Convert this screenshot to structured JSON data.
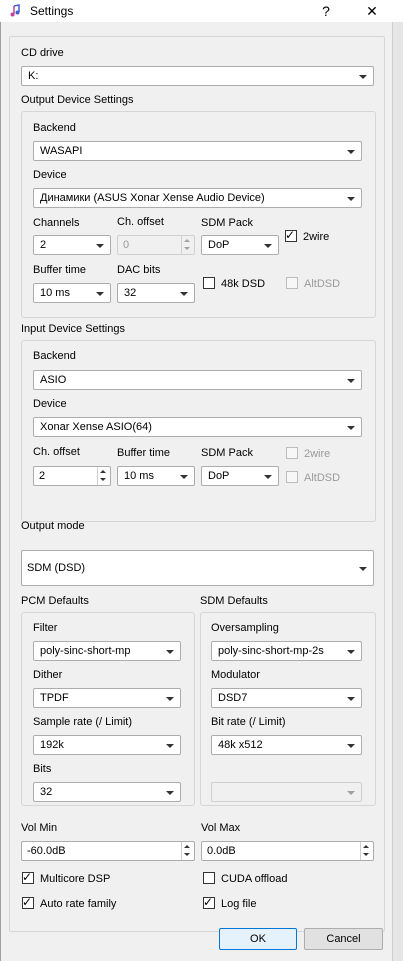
{
  "window": {
    "title": "Settings",
    "help": "?",
    "close": "✕"
  },
  "cd_drive": {
    "label": "CD drive",
    "value": "K:"
  },
  "output": {
    "heading": "Output Device Settings",
    "backend_label": "Backend",
    "backend": "WASAPI",
    "device_label": "Device",
    "device": "Динамики (ASUS Xonar Xense Audio Device)",
    "channels_label": "Channels",
    "channels": "2",
    "ch_offset_label": "Ch. offset",
    "ch_offset": "0",
    "sdm_pack_label": "SDM Pack",
    "sdm_pack": "DoP",
    "twowire_label": "2wire",
    "twowire_checked": true,
    "buffer_time_label": "Buffer time",
    "buffer_time": "10 ms",
    "dac_bits_label": "DAC bits",
    "dac_bits": "32",
    "dsd48k_label": "48k DSD",
    "dsd48k_checked": false,
    "altdsd_label": "AltDSD",
    "altdsd_checked": false
  },
  "input": {
    "heading": "Input Device Settings",
    "backend_label": "Backend",
    "backend": "ASIO",
    "device_label": "Device",
    "device": "Xonar Xense ASIO(64)",
    "ch_offset_label": "Ch. offset",
    "ch_offset": "2",
    "buffer_time_label": "Buffer time",
    "buffer_time": "10 ms",
    "sdm_pack_label": "SDM Pack",
    "sdm_pack": "DoP",
    "twowire_label": "2wire",
    "twowire_checked": false,
    "altdsd_label": "AltDSD",
    "altdsd_checked": false
  },
  "output_mode": {
    "label": "Output mode",
    "value": "SDM (DSD)"
  },
  "pcm": {
    "heading": "PCM Defaults",
    "filter_label": "Filter",
    "filter": "poly-sinc-short-mp",
    "dither_label": "Dither",
    "dither": "TPDF",
    "sample_rate_label": "Sample rate (/ Limit)",
    "sample_rate": "192k",
    "bits_label": "Bits",
    "bits": "32"
  },
  "sdm": {
    "heading": "SDM Defaults",
    "oversampling_label": "Oversampling",
    "oversampling": "poly-sinc-short-mp-2s",
    "modulator_label": "Modulator",
    "modulator": "DSD7",
    "bit_rate_label": "Bit rate (/ Limit)",
    "bit_rate": "48k x512",
    "extra": ""
  },
  "vol": {
    "min_label": "Vol Min",
    "min": "-60.0dB",
    "max_label": "Vol Max",
    "max": "0.0dB"
  },
  "options": {
    "multicore_label": "Multicore DSP",
    "multicore_checked": true,
    "cuda_label": "CUDA offload",
    "cuda_checked": false,
    "auto_rate_label": "Auto rate family",
    "auto_rate_checked": true,
    "logfile_label": "Log file",
    "logfile_checked": true
  },
  "buttons": {
    "ok": "OK",
    "cancel": "Cancel"
  },
  "colors": {
    "accent": "#0078d7",
    "background": "#f0f0f0",
    "border": "#adadad"
  }
}
